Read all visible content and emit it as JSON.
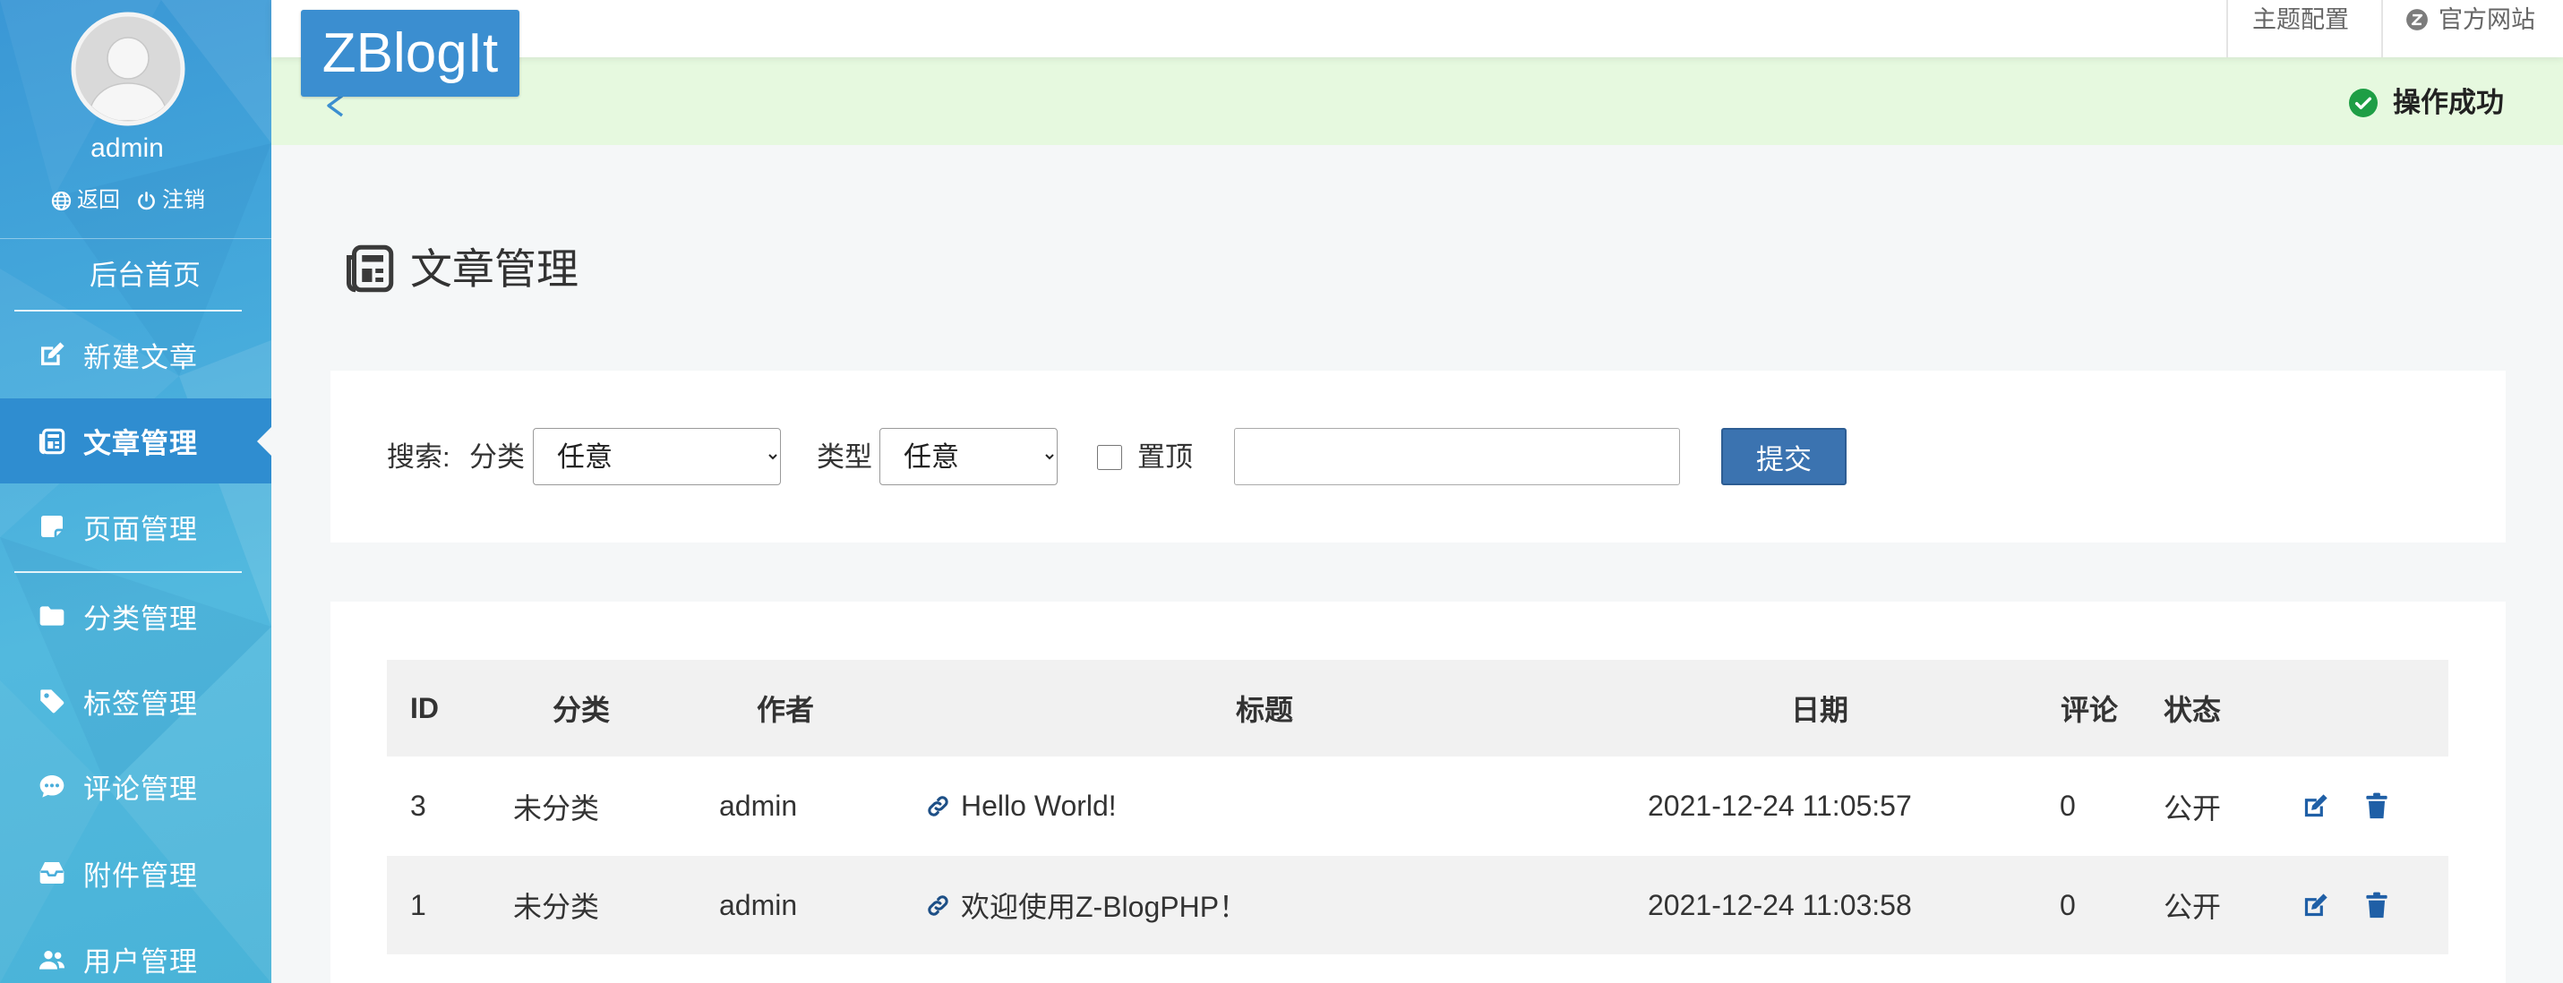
{
  "sidebar": {
    "username": "admin",
    "back_label": "返回",
    "logout_label": "注销",
    "home_label": "后台首页",
    "items": [
      {
        "label": "新建文章",
        "icon": "edit-icon",
        "active": false
      },
      {
        "label": "文章管理",
        "icon": "article-icon",
        "active": true
      },
      {
        "label": "页面管理",
        "icon": "page-icon",
        "active": false
      },
      {
        "label": "分类管理",
        "icon": "folder-icon",
        "active": false
      },
      {
        "label": "标签管理",
        "icon": "tag-icon",
        "active": false
      },
      {
        "label": "评论管理",
        "icon": "comment-icon",
        "active": false
      },
      {
        "label": "附件管理",
        "icon": "attachment-icon",
        "active": false
      },
      {
        "label": "用户管理",
        "icon": "users-icon",
        "active": false
      }
    ]
  },
  "header": {
    "logo": "ZBlogIt",
    "theme_config_label": "主题配置",
    "official_site_label": "官方网站"
  },
  "notice": {
    "message": "操作成功",
    "icon": "check-circle-icon"
  },
  "page": {
    "title": "文章管理"
  },
  "search": {
    "label": "搜索:",
    "category_label": "分类",
    "category_value": "任意",
    "type_label": "类型",
    "type_value": "任意",
    "sticky_label": "置顶",
    "sticky_checked": false,
    "keyword_value": "",
    "submit_label": "提交"
  },
  "table": {
    "columns": [
      "ID",
      "分类",
      "作者",
      "标题",
      "日期",
      "评论",
      "状态"
    ],
    "rows": [
      {
        "id": "3",
        "category": "未分类",
        "author": "admin",
        "title": "Hello World!",
        "date": "2021-12-24 11:05:57",
        "comments": "0",
        "status": "公开"
      },
      {
        "id": "1",
        "category": "未分类",
        "author": "admin",
        "title": "欢迎使用Z-BlogPHP！",
        "date": "2021-12-24 11:03:58",
        "comments": "0",
        "status": "公开"
      }
    ]
  },
  "colors": {
    "sidebar_bg": "#45aadb",
    "sidebar_active": "#2f8dd0",
    "logo_bg": "#3b8ed0",
    "notice_bg": "#e6f9df",
    "success": "#1e9e45",
    "primary_button": "#3b73b0",
    "action_icon": "#1f5fa6",
    "page_bg": "#f5f7f8"
  }
}
